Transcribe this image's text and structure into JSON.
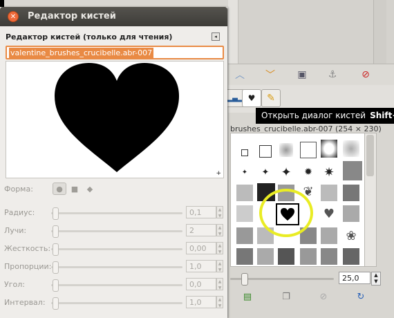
{
  "dialog": {
    "title": "Редактор кистей",
    "panel_title": "Редактор кистей (только для чтения)",
    "brush_name": "valentine_brushes_crucibelle.abr-007",
    "properties": [
      {
        "label": "Форма:",
        "type": "shape"
      },
      {
        "label": "Радиус:",
        "value": "0,1"
      },
      {
        "label": "Лучи:",
        "value": "2"
      },
      {
        "label": "Жесткость:",
        "value": "0,00"
      },
      {
        "label": "Пропорции:",
        "value": "1,0"
      },
      {
        "label": "Угол:",
        "value": "0,0"
      },
      {
        "label": "Интервал:",
        "value": "1,0"
      }
    ],
    "shapes": [
      "circle",
      "square",
      "diamond"
    ]
  },
  "brushes_panel": {
    "tooltip_text": "Открыть диалог кистей",
    "tooltip_shortcut": "Shift+C",
    "brush_info": "brushes_crucibelle.abr-007 (254 × 230)",
    "spacing_value": "25,0"
  },
  "colors": {
    "accent": "#e98a44",
    "highlight": "#e9ec24",
    "titlebar": "#3d3c38",
    "close": "#ef6a3a"
  }
}
